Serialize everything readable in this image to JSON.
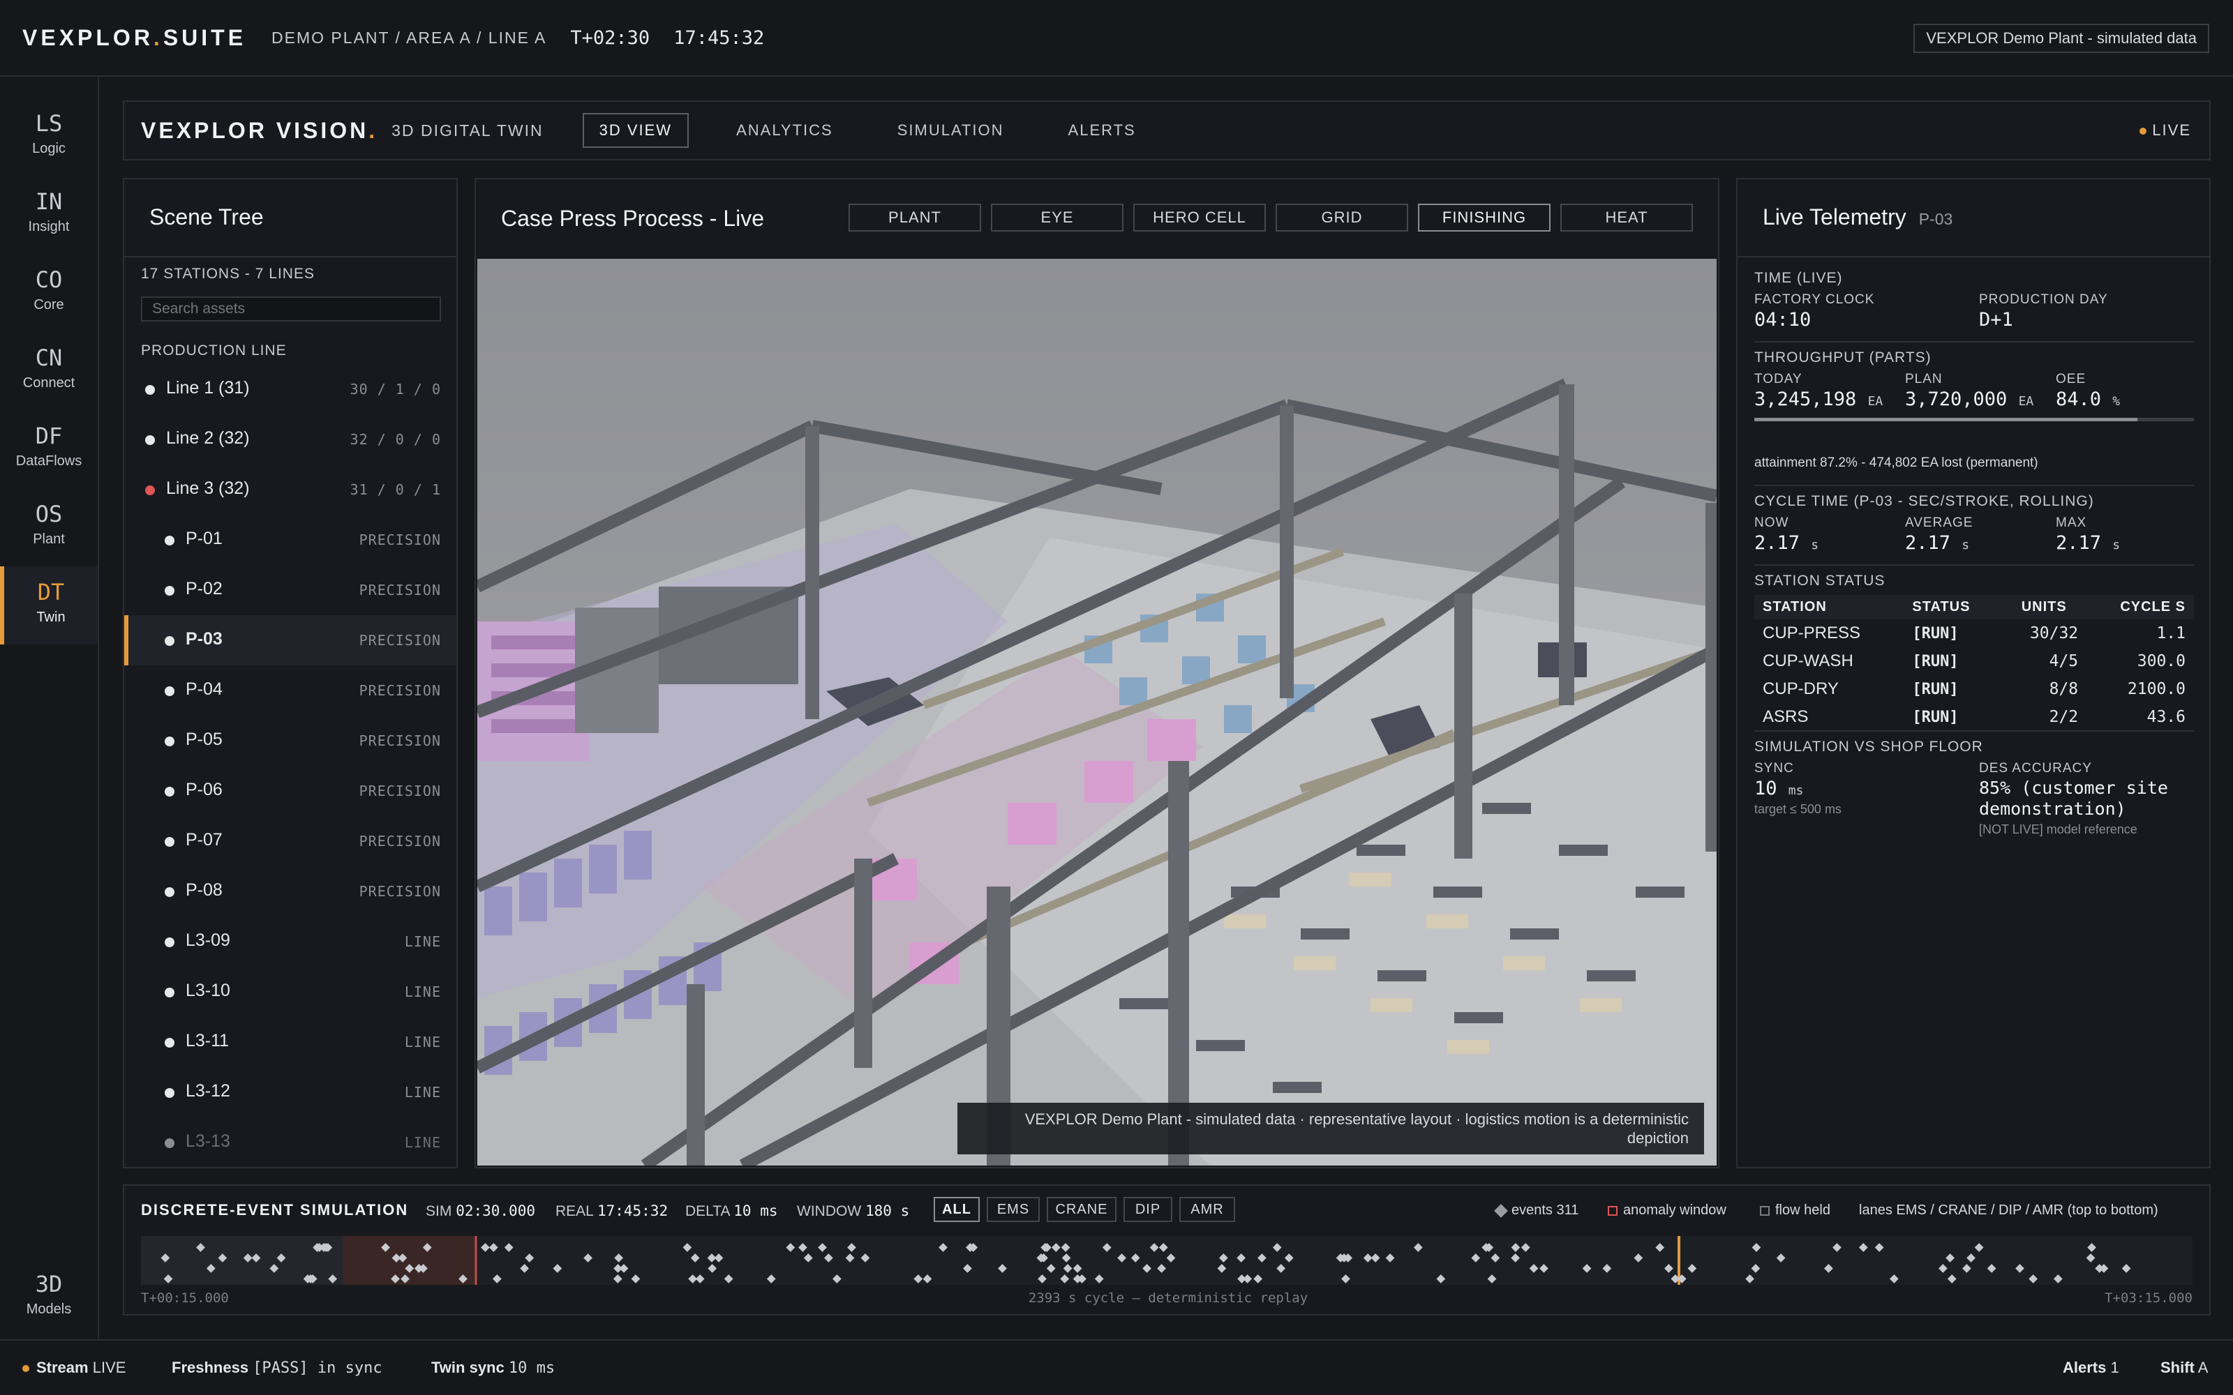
{
  "app": {
    "brand_a": "VEXPLOR",
    "brand_dot": ".",
    "brand_b": "SUITE",
    "breadcrumb": "DEMO PLANT / AREA A / LINE A",
    "tplus": "T+02:30",
    "clock": "17:45:32",
    "data_note": "VEXPLOR Demo Plant - simulated data"
  },
  "rail": [
    {
      "code": "LS",
      "label": "Logic"
    },
    {
      "code": "IN",
      "label": "Insight"
    },
    {
      "code": "CO",
      "label": "Core"
    },
    {
      "code": "CN",
      "label": "Connect"
    },
    {
      "code": "DF",
      "label": "DataFlows"
    },
    {
      "code": "OS",
      "label": "Plant"
    },
    {
      "code": "DT",
      "label": "Twin"
    },
    {
      "code": "3D",
      "label": "Models"
    }
  ],
  "vision": {
    "brand": "VEXPLOR VISION",
    "brand_dot": ".",
    "subtitle": "3D DIGITAL TWIN",
    "tabs": [
      "3D VIEW",
      "ANALYTICS",
      "SIMULATION",
      "ALERTS"
    ],
    "live": "LIVE"
  },
  "scene_tree": {
    "title": "Scene Tree",
    "count": "17 STATIONS - 7 LINES",
    "search_placeholder": "Search assets",
    "section": "PRODUCTION LINE",
    "rows": [
      {
        "name": "Line 1 (31)",
        "meta": "30 / 1 / 0"
      },
      {
        "name": "Line 2 (32)",
        "meta": "32 / 0 / 0"
      },
      {
        "name": "Line 3 (32)",
        "meta": "31 / 0 / 1"
      },
      {
        "name": "P-01",
        "meta": "PRECISION"
      },
      {
        "name": "P-02",
        "meta": "PRECISION"
      },
      {
        "name": "P-03",
        "meta": "PRECISION"
      },
      {
        "name": "P-04",
        "meta": "PRECISION"
      },
      {
        "name": "P-05",
        "meta": "PRECISION"
      },
      {
        "name": "P-06",
        "meta": "PRECISION"
      },
      {
        "name": "P-07",
        "meta": "PRECISION"
      },
      {
        "name": "P-08",
        "meta": "PRECISION"
      },
      {
        "name": "L3-09",
        "meta": "LINE"
      },
      {
        "name": "L3-10",
        "meta": "LINE"
      },
      {
        "name": "L3-11",
        "meta": "LINE"
      },
      {
        "name": "L3-12",
        "meta": "LINE"
      },
      {
        "name": "L3-13",
        "meta": "LINE"
      }
    ]
  },
  "viewport": {
    "title": "Case Press Process - Live",
    "buttons": [
      "PLANT",
      "EYE",
      "HERO CELL",
      "GRID",
      "FINISHING",
      "HEAT"
    ],
    "caption": "VEXPLOR Demo Plant - simulated data · representative layout · logistics motion is a deterministic depiction"
  },
  "telemetry": {
    "title": "Live Telemetry",
    "station": "P-03",
    "time_h": "TIME (LIVE)",
    "factory_clock_k": "FACTORY CLOCK",
    "factory_clock_v": "04:10",
    "prod_day_k": "PRODUCTION DAY",
    "prod_day_v": "D+1",
    "throughput_h": "THROUGHPUT (PARTS)",
    "today_k": "TODAY",
    "today_v": "3,245,198",
    "today_u": "EA",
    "plan_k": "PLAN",
    "plan_v": "3,720,000",
    "plan_u": "EA",
    "oee_k": "OEE",
    "oee_v": "84.0",
    "oee_u": "%",
    "attainment": "attainment 87.2% - 474,802 EA lost (permanent)",
    "cycle_h": "CYCLE TIME (P-03 - SEC/STROKE, ROLLING)",
    "now_k": "NOW",
    "now_v": "2.17",
    "avg_k": "AVERAGE",
    "avg_v": "2.17",
    "max_k": "MAX",
    "max_v": "2.17",
    "sec_u": "s",
    "status_h": "STATION STATUS",
    "columns": [
      "STATION",
      "STATUS",
      "UNITS",
      "CYCLE S"
    ],
    "stations": [
      {
        "station": "CUP-PRESS",
        "status": "[RUN]",
        "units": "30/32",
        "cycle": "1.1"
      },
      {
        "station": "CUP-WASH",
        "status": "[RUN]",
        "units": "4/5",
        "cycle": "300.0"
      },
      {
        "station": "CUP-DRY",
        "status": "[RUN]",
        "units": "8/8",
        "cycle": "2100.0"
      },
      {
        "station": "ASRS",
        "status": "[RUN]",
        "units": "2/2",
        "cycle": "43.6"
      }
    ],
    "sim_h": "SIMULATION VS SHOP FLOOR",
    "sync_k": "SYNC",
    "sync_v": "10",
    "sync_u": "ms",
    "sync_target": "target ≤ 500 ms",
    "des_k": "DES ACCURACY",
    "des_v": "85% (customer site demonstration)",
    "des_note": "[NOT LIVE] model reference",
    "throughput_progress": 0.872
  },
  "des": {
    "title": "DISCRETE-EVENT SIMULATION",
    "sim_k": "SIM",
    "sim_v": "02:30.000",
    "real_k": "REAL",
    "real_v": "17:45:32",
    "delta_k": "DELTA",
    "delta_v": "10 ms",
    "window_k": "WINDOW",
    "window_v": "180 s",
    "filters": [
      "ALL",
      "EMS",
      "CRANE",
      "DIP",
      "AMR"
    ],
    "legend_events": "events 311",
    "legend_anomaly": "anomaly window",
    "legend_flow": "flow held",
    "legend_lanes": "lanes EMS / CRANE / DIP / AMR (top to bottom)",
    "start": "T+00:15.000",
    "middle": "2393 s cycle — deterministic replay",
    "end": "T+03:15.000"
  },
  "footer": {
    "stream_k": "Stream",
    "stream_v": "LIVE",
    "fresh_k": "Freshness",
    "fresh_v": "[PASS] in sync",
    "twin_k": "Twin sync",
    "twin_v": "10 ms",
    "alerts_k": "Alerts",
    "alerts_v": "1",
    "shift_k": "Shift",
    "shift_v": "A"
  },
  "colors": {
    "accent": "#e69a3c",
    "alarm": "#e05555",
    "bg": "#15171b"
  }
}
